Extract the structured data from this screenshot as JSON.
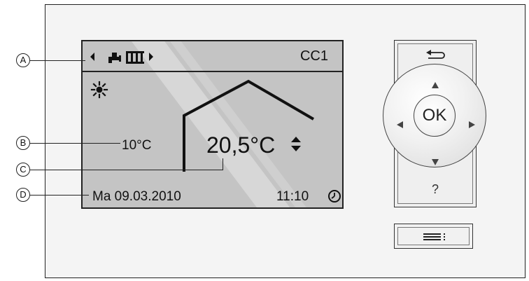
{
  "callouts": [
    "A",
    "B",
    "C",
    "D"
  ],
  "display": {
    "header_title": "CC1",
    "outdoor_temperature": "10°C",
    "room_temperature": "20,5°C",
    "date": "Ma 09.03.2010",
    "time": "11:10",
    "icons": [
      "arrow-left-icon",
      "water-tap-icon",
      "radiator-icon",
      "arrow-right-icon",
      "sun-icon",
      "house-icon",
      "up-down-adjust-icon",
      "clock-icon"
    ]
  },
  "controls": {
    "back_icon": "back-arrow-icon",
    "ok_label": "OK",
    "help_label": "?",
    "menu_icon": "menu-icon",
    "direction_icons": [
      "arrow-up-icon",
      "arrow-left-icon",
      "arrow-right-icon",
      "arrow-down-icon"
    ]
  },
  "colors": {
    "frame": "#f4f4f4",
    "screen": "#c4c4c4",
    "outline": "#222222"
  }
}
